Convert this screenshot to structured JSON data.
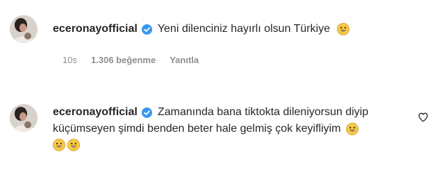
{
  "comments": [
    {
      "username": "eceronayofficial",
      "text": "Yeni dilenciniz hayırlı olsun Türkiye",
      "time": "10s",
      "likes": "1.306 beğenme",
      "reply_label": "Yanıtla",
      "verified": true,
      "emojis": [
        "grinning-face"
      ]
    },
    {
      "username": "eceronayofficial",
      "text_line1": "Zamanında bana tiktokta dileniyorsun diyip",
      "text_line2": "küçümseyen şimdi benden beter hale gelmiş çok keyifliyim",
      "verified": true,
      "emojis": [
        "grinning-face",
        "grinning-face",
        "grinning-face"
      ],
      "like_icon": "heart-outline-icon"
    }
  ],
  "colors": {
    "text": "#262626",
    "meta": "#8e8e8e",
    "verified": "#3897f0",
    "emoji": "#f7c948"
  }
}
